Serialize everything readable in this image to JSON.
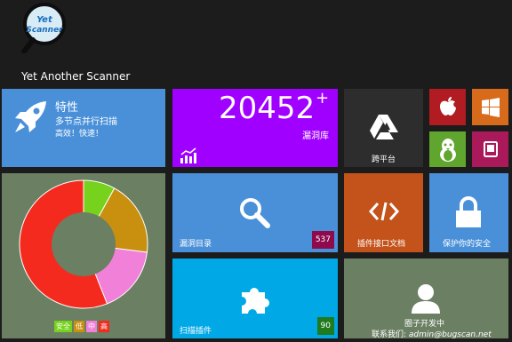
{
  "app": {
    "logo_text_1": "Yet",
    "logo_text_2": "Scanner",
    "title": "Yet Another Scanner"
  },
  "tiles": {
    "features": {
      "heading": "特性",
      "line1": "多节点并行扫描",
      "line2": "高效！快速！",
      "color": "#4a90d9",
      "icon": "rocket-icon"
    },
    "vuln_db": {
      "count": "20452",
      "plus": "+",
      "label": "漏洞库",
      "color": "#a000ff",
      "icon": "rising-chart-icon"
    },
    "cross_platform": {
      "label": "跨平台",
      "color": "#2d2d2d",
      "icon": "google-drive-icon"
    },
    "apple": {
      "color": "#b01c22",
      "icon": "apple-icon"
    },
    "windows": {
      "color": "#d86a1c",
      "icon": "windows-icon"
    },
    "linux": {
      "color": "#60a62e",
      "icon": "linux-icon"
    },
    "mobile": {
      "color": "#aa1a5a",
      "icon": "tablet-icon"
    },
    "vuln_catalog": {
      "label": "漏洞目录",
      "count": "537",
      "count_color": "#8e0a4c",
      "color": "#4a90d9",
      "icon": "search-icon"
    },
    "plugin_docs": {
      "label": "插件接口文档",
      "color": "#c4531b",
      "icon": "code-icon"
    },
    "security": {
      "label": "保护你的安全",
      "color": "#4a90d9",
      "icon": "lock-icon"
    },
    "plugins": {
      "label": "扫描插件",
      "count": "90",
      "count_color": "#207a1e",
      "color": "#00a8e6",
      "icon": "puzzle-icon"
    },
    "community": {
      "line1": "圈子开发中",
      "line2_prefix": "联系我们:",
      "line2_email": "admin@bugscan.net",
      "color": "#6b7f63",
      "icon": "user-icon"
    }
  },
  "chart_data": {
    "type": "pie",
    "variant": "donut",
    "background": "#6b7f63",
    "categories": [
      "安全",
      "低",
      "中",
      "高"
    ],
    "values": [
      8,
      19,
      17,
      56
    ],
    "colors": [
      "#76d21c",
      "#c8900e",
      "#f080d8",
      "#f52a1e"
    ]
  }
}
